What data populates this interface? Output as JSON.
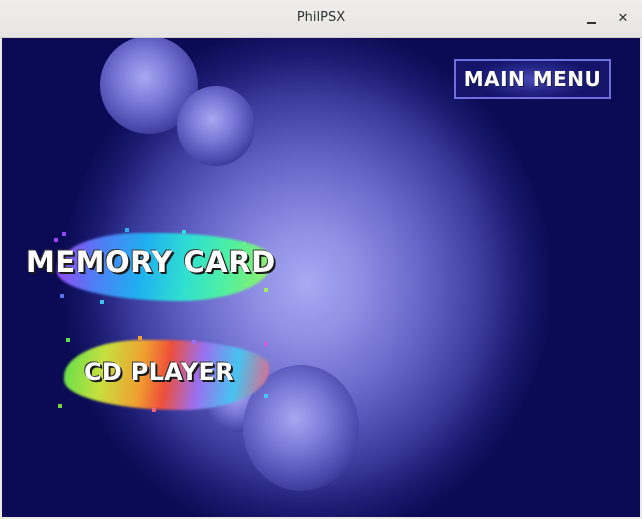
{
  "window": {
    "title": "PhilPSX",
    "minimize_icon": "minimize-icon",
    "close_icon": "close-icon",
    "close_glyph": "✕"
  },
  "menu": {
    "main_menu_label": "MAIN MENU",
    "memory_card_label": "MEMORY CARD",
    "cd_player_label": "CD PLAYER"
  },
  "colors": {
    "background_dark": "#0b0b55",
    "background_glow": "#a9a9f4",
    "button_border": "#6f6fe0"
  }
}
